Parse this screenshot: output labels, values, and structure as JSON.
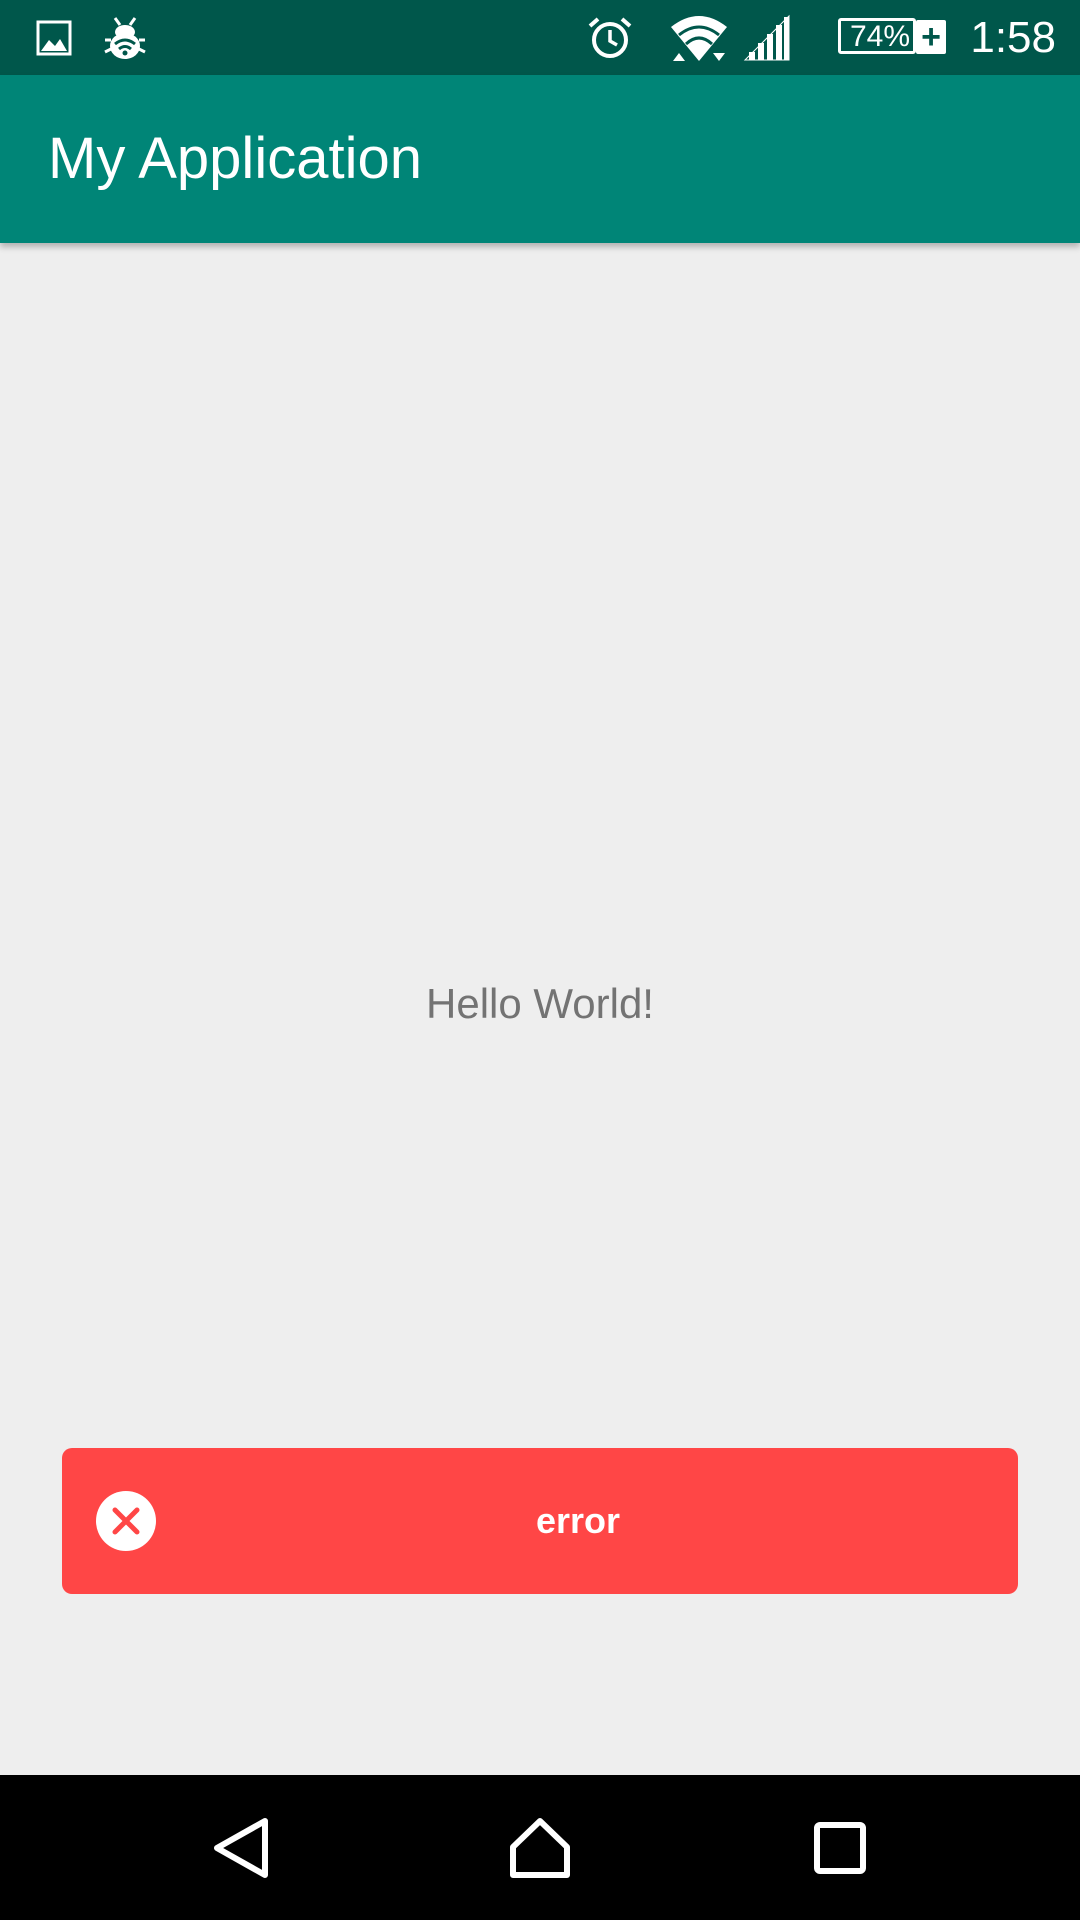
{
  "status_bar": {
    "time": "1:58",
    "battery_level": "74%",
    "battery_charging_symbol": "+",
    "icons": [
      "image-icon",
      "bug-icon",
      "alarm-icon",
      "wifi-icon",
      "cell-signal-icon",
      "battery-icon"
    ],
    "background": "#00574b"
  },
  "app_bar": {
    "title": "My Application",
    "background": "#008577"
  },
  "content": {
    "message": "Hello World!"
  },
  "toast": {
    "message": "error",
    "icon": "error-x-icon",
    "background": "#ff4646"
  },
  "nav_bar": {
    "buttons": [
      "back-icon",
      "home-icon",
      "recents-icon"
    ]
  }
}
